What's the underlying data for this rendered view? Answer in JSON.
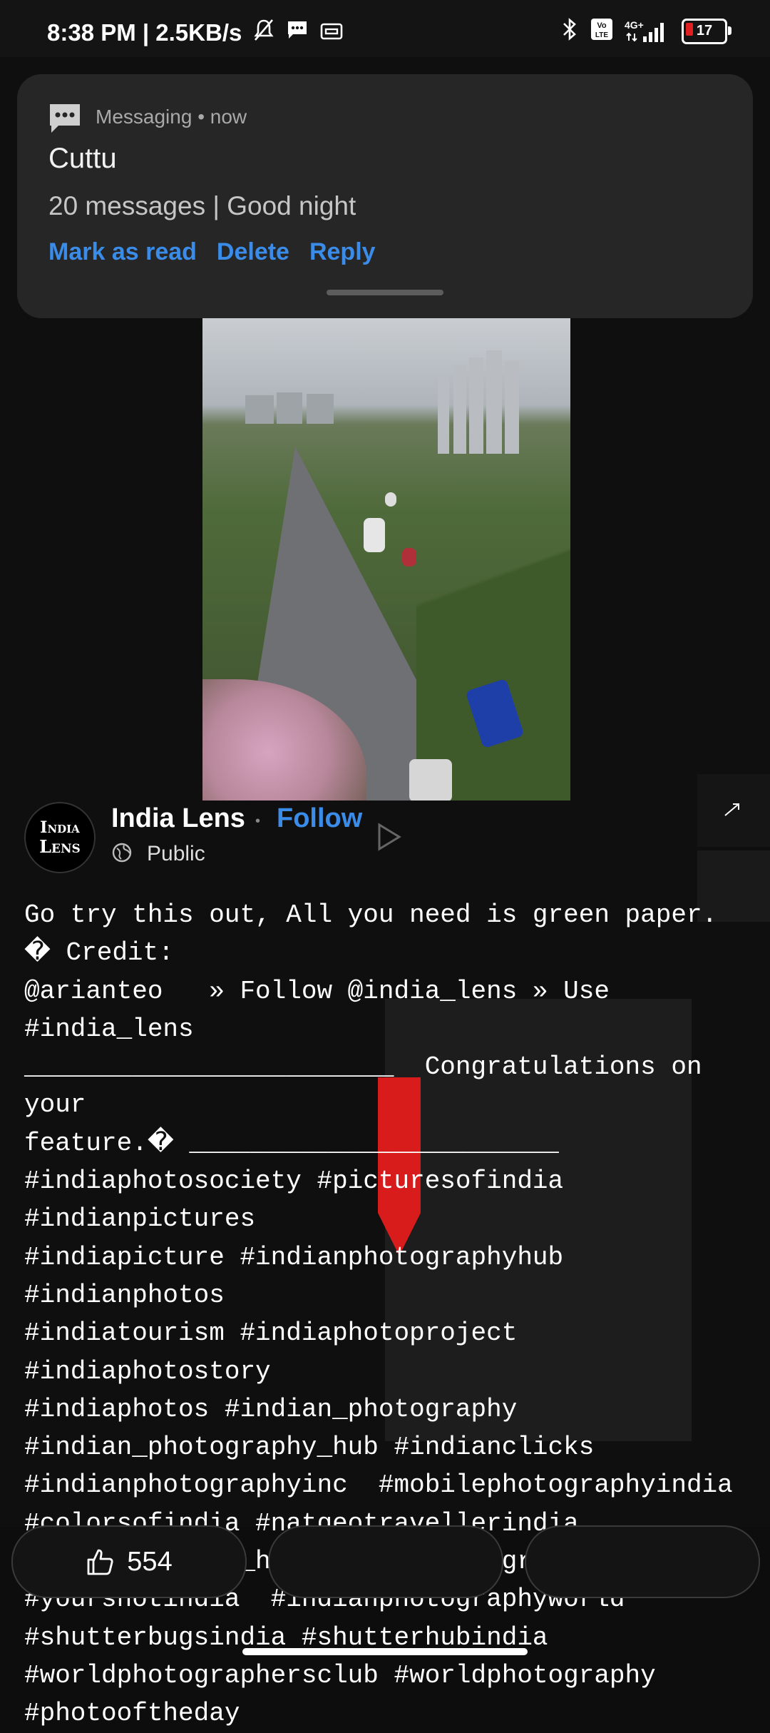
{
  "status_bar": {
    "time_speed": "8:38 PM | 2.5KB/s",
    "network": "4G+",
    "battery_level": "17",
    "icons": [
      "mute-bell-icon",
      "message-icon",
      "card-icon",
      "bluetooth-icon",
      "volte-icon",
      "signal-icon",
      "battery-icon"
    ]
  },
  "notification": {
    "app_name": "Messaging",
    "time": "now",
    "sender": "Cuttu",
    "message": "20 messages | Good night",
    "actions": [
      "Mark as read",
      "Delete",
      "Reply"
    ]
  },
  "post": {
    "author": "India Lens",
    "avatar_line1": "India",
    "avatar_line2": "Lens",
    "separator": "•",
    "follow_label": "Follow",
    "audience": "Public",
    "caption": "Go try this out, All you need is green paper.   � Credit:\n@arianteo   » Follow @india_lens » Use #india_lens\n________________________  Congratulations on your\nfeature.� ________________________\n#indiaphotosociety #picturesofindia #indianpictures\n#indiapicture #indianphotographyhub #indianphotos\n#indiatourism #indiaphotoproject #indiaphotostory\n#indiaphotos #indian_photography\n#indian_photography_hub #indianclicks\n#indianphotographyinc  #mobilephotographyindia\n#colorsofindia #natgeotravellerindia\n#photographers_hub_india #photographersteam\n#yourshotindia  #indianphotographyworld\n#shutterbugsindia #shutterhubindia\n#worldphotographersclub #worldphotography\n#photooftheday",
    "like_count": "554"
  },
  "colors": {
    "accent": "#3a8ce8",
    "background": "#0d0d0d",
    "notification_bg": "#262626",
    "battery_low": "#e02020"
  }
}
